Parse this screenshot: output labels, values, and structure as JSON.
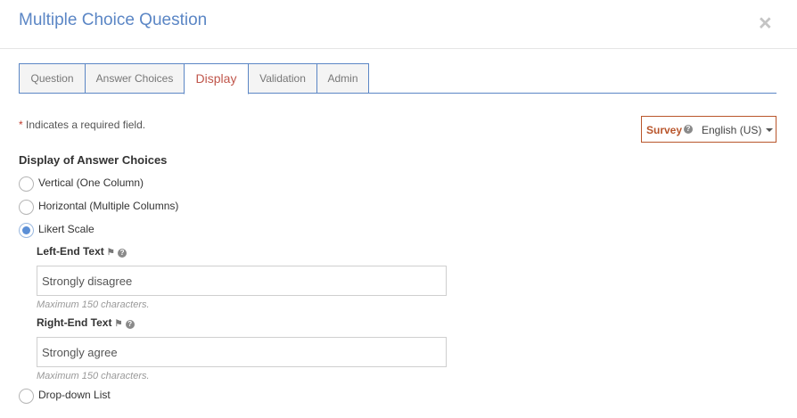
{
  "dialog": {
    "title": "Multiple Choice Question",
    "close_glyph": "×"
  },
  "tabs": [
    {
      "label": "Question"
    },
    {
      "label": "Answer Choices"
    },
    {
      "label": "Display",
      "active": true
    },
    {
      "label": "Validation"
    },
    {
      "label": "Admin"
    }
  ],
  "required_note": {
    "star": "*",
    "text": " Indicates a required field."
  },
  "language": {
    "label": "Survey",
    "help_glyph": "?",
    "value": "English (US)"
  },
  "display": {
    "title": "Display of Answer Choices",
    "options": [
      {
        "label": "Vertical (One Column)",
        "checked": false
      },
      {
        "label": "Horizontal (Multiple Columns)",
        "checked": false
      },
      {
        "label": "Likert Scale",
        "checked": true
      },
      {
        "label": "Drop-down List",
        "checked": false
      }
    ],
    "left_end": {
      "label": "Left-End Text",
      "translate_glyph": "⚑",
      "help_glyph": "?",
      "value": "Strongly disagree",
      "hint": "Maximum 150 characters."
    },
    "right_end": {
      "label": "Right-End Text",
      "translate_glyph": "⚑",
      "help_glyph": "?",
      "value": "Strongly agree",
      "hint": "Maximum 150 characters."
    }
  },
  "colors": {
    "accent": "#5b86c5",
    "active_tab": "#c0564b",
    "language_border": "#b9562c",
    "radio_selected": "#5b8fd6"
  }
}
